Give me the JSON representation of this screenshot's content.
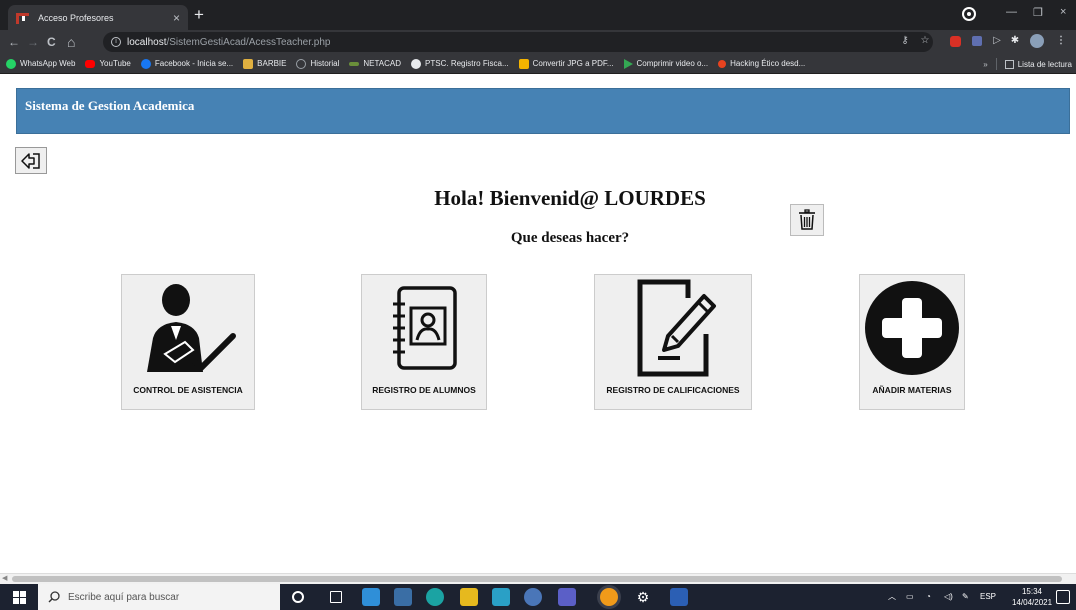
{
  "browser": {
    "tab_title": "Acceso Profesores",
    "tab_close": "×",
    "new_tab": "+",
    "url_host": "localhost",
    "url_path": "/SistemGestiAcad/AcessTeacher.php",
    "nav": {
      "back": "←",
      "forward": "→",
      "reload": "C",
      "home": "⌂"
    },
    "window_controls": {
      "minimize": "—",
      "restore": "❐",
      "close": "×"
    },
    "bookmarks": [
      {
        "label": "WhatsApp Web",
        "color": "#25d366"
      },
      {
        "label": "YouTube",
        "color": "#ff0000"
      },
      {
        "label": "Facebook - Inicia se...",
        "color": "#1877f2"
      },
      {
        "label": "BARBIE",
        "color": "#e0b040"
      },
      {
        "label": "Historial",
        "color": "#9aa0a6"
      },
      {
        "label": "NETACAD",
        "color": "#6a8f3a"
      },
      {
        "label": "PTSC. Registro Fisca...",
        "color": "#e8eaed"
      },
      {
        "label": "Convertir JPG a PDF...",
        "color": "#f4b400"
      },
      {
        "label": "Comprimir video o...",
        "color": "#34a853"
      },
      {
        "label": "Hacking Ético desd...",
        "color": "#e8431f"
      }
    ],
    "bookmarks_overflow": "»",
    "reading_list": "Lista de lectura"
  },
  "app": {
    "title": "Sistema de Gestion Academica",
    "welcome": "Hola! Bienvenid@ LOURDES",
    "question": "Que deseas hacer?",
    "cards": [
      {
        "label": "CONTROL DE ASISTENCIA",
        "icon": "teacher-check-icon"
      },
      {
        "label": "REGISTRO DE ALUMNOS",
        "icon": "address-book-icon"
      },
      {
        "label": "REGISTRO DE CALIFICACIONES",
        "icon": "edit-document-icon"
      },
      {
        "label": "AÑADIR MATERIAS",
        "icon": "add-circle-icon"
      }
    ]
  },
  "taskbar": {
    "search_placeholder": "Escribe aquí para buscar",
    "language": "ESP",
    "time": "15:34",
    "date": "14/04/2021"
  },
  "colors": {
    "header_bg": "#4682b4",
    "chrome_dark": "#202124",
    "chrome_toolbar": "#35363a",
    "taskbar": "#1c2230"
  }
}
